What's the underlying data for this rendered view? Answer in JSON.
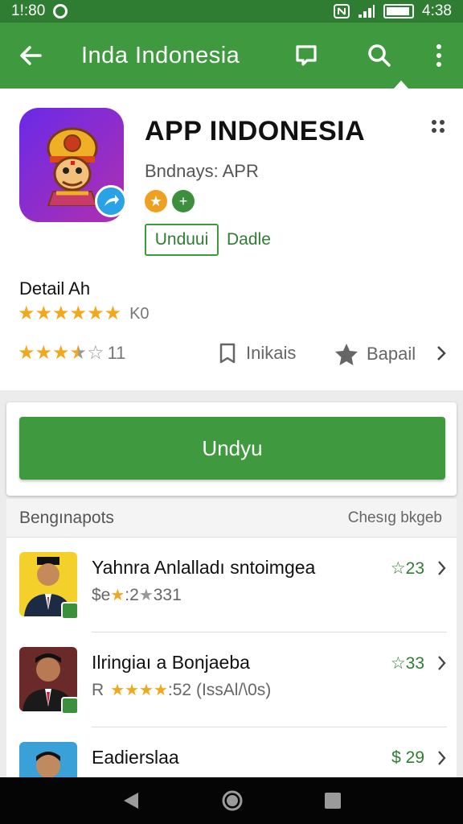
{
  "status_bar": {
    "time": "1!:80",
    "battery_time": "4:38",
    "icons": [
      "status-dot-icon",
      "nfc-icon",
      "signal-icon",
      "battery-icon"
    ]
  },
  "toolbar": {
    "title": "Inda Indonesia",
    "icons": [
      "back-arrow-icon",
      "chat-icon",
      "search-icon",
      "more-vert-icon"
    ]
  },
  "app": {
    "title": "APP INDONESIA",
    "developer": "Bndnays: APR",
    "install_button": "Unduui",
    "secondary_link": "Dadle",
    "detail_label": "Detail Ah",
    "review_stars": 5,
    "review_count": "K0",
    "rating_count": "11",
    "rating_value": 3.5,
    "install_label": "Inikais",
    "share_label": "Bapail"
  },
  "action": {
    "primary_button": "Undyu"
  },
  "list": {
    "header_left": "Bengınapots",
    "header_right": "Chesıg bkgeb",
    "items": [
      {
        "name": "Yahnra Anlalladı sntoimgea",
        "sub_prefix": "$e",
        "sub_text": ":2",
        "sub_suffix": "331",
        "price": "23"
      },
      {
        "name": "Ilringiaı a Bonjaeba",
        "sub_prefix": "R",
        "sub_text": ":52 (IssAl/\\0s)",
        "price": "33"
      },
      {
        "name": "Eadierslaa",
        "sub_prefix": "",
        "sub_text": "",
        "price": "$ 29"
      }
    ]
  },
  "colors": {
    "primary": "#3f9a3f",
    "primary_dark": "#2f7d32",
    "star": "#f2a81d"
  }
}
